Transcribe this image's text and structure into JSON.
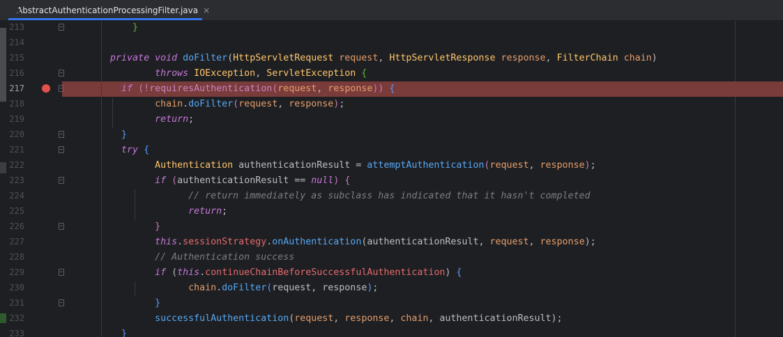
{
  "tab": {
    "filename": "AbstractAuthenticationProcessingFilter.java",
    "close": "×"
  },
  "editor": {
    "breakpoint_line": "217",
    "lines": [
      {
        "num": "213",
        "indent": 0,
        "tokens": [
          {
            "t": "        ",
            "c": "plain"
          },
          {
            "t": "}",
            "c": "brace-g"
          }
        ]
      },
      {
        "num": "214",
        "tokens": []
      },
      {
        "num": "215",
        "tokens": [
          {
            "t": "    ",
            "c": "plain"
          },
          {
            "t": "private ",
            "c": "purpleK"
          },
          {
            "t": "void ",
            "c": "purpleK"
          },
          {
            "t": "doFilter",
            "c": "fn"
          },
          {
            "t": "(",
            "c": "plain"
          },
          {
            "t": "HttpServletRequest ",
            "c": "tyY"
          },
          {
            "t": "request",
            "c": "arg"
          },
          {
            "t": ", ",
            "c": "plain"
          },
          {
            "t": "HttpServletResponse ",
            "c": "tyY"
          },
          {
            "t": "response",
            "c": "arg"
          },
          {
            "t": ", ",
            "c": "plain"
          },
          {
            "t": "FilterChain ",
            "c": "tyY"
          },
          {
            "t": "chain",
            "c": "arg"
          },
          {
            "t": ")",
            "c": "plain"
          }
        ]
      },
      {
        "num": "216",
        "tokens": [
          {
            "t": "            ",
            "c": "plain"
          },
          {
            "t": "throws ",
            "c": "purpleK"
          },
          {
            "t": "IOException",
            "c": "tyY"
          },
          {
            "t": ", ",
            "c": "plain"
          },
          {
            "t": "ServletException ",
            "c": "tyY"
          },
          {
            "t": "{",
            "c": "brace-g"
          }
        ]
      },
      {
        "num": "217",
        "tokens": [
          {
            "t": "      ",
            "c": "plain"
          },
          {
            "t": "if ",
            "c": "purpleK"
          },
          {
            "t": "(!",
            "c": "brace-p"
          },
          {
            "t": "requiresAuthentication",
            "c": "call"
          },
          {
            "t": "(",
            "c": "brace-p"
          },
          {
            "t": "request",
            "c": "arg"
          },
          {
            "t": ", ",
            "c": "plain"
          },
          {
            "t": "response",
            "c": "arg"
          },
          {
            "t": ")) ",
            "c": "brace-p"
          },
          {
            "t": "{",
            "c": "brace-b"
          }
        ]
      },
      {
        "num": "218",
        "tokens": [
          {
            "t": "            ",
            "c": "plain"
          },
          {
            "t": "chain",
            "c": "arg"
          },
          {
            "t": ".",
            "c": "plain"
          },
          {
            "t": "doFilter",
            "c": "fn"
          },
          {
            "t": "(",
            "c": "brace-p"
          },
          {
            "t": "request",
            "c": "arg"
          },
          {
            "t": ", ",
            "c": "plain"
          },
          {
            "t": "response",
            "c": "arg"
          },
          {
            "t": ")",
            "c": "brace-p"
          },
          {
            "t": ";",
            "c": "plain"
          }
        ]
      },
      {
        "num": "219",
        "tokens": [
          {
            "t": "            ",
            "c": "plain"
          },
          {
            "t": "return",
            "c": "ret"
          },
          {
            "t": ";",
            "c": "plain"
          }
        ]
      },
      {
        "num": "220",
        "tokens": [
          {
            "t": "      ",
            "c": "plain"
          },
          {
            "t": "}",
            "c": "brace-b"
          }
        ]
      },
      {
        "num": "221",
        "tokens": [
          {
            "t": "      ",
            "c": "plain"
          },
          {
            "t": "try ",
            "c": "purpleK"
          },
          {
            "t": "{",
            "c": "brace-b"
          }
        ]
      },
      {
        "num": "222",
        "tokens": [
          {
            "t": "            ",
            "c": "plain"
          },
          {
            "t": "Authentication ",
            "c": "tyY"
          },
          {
            "t": "authenticationResult = ",
            "c": "plain"
          },
          {
            "t": "attemptAuthentication",
            "c": "fn"
          },
          {
            "t": "(",
            "c": "brace-p"
          },
          {
            "t": "request",
            "c": "arg"
          },
          {
            "t": ", ",
            "c": "plain"
          },
          {
            "t": "response",
            "c": "arg"
          },
          {
            "t": ")",
            "c": "brace-p"
          },
          {
            "t": ";",
            "c": "plain"
          }
        ]
      },
      {
        "num": "223",
        "tokens": [
          {
            "t": "            ",
            "c": "plain"
          },
          {
            "t": "if ",
            "c": "purpleK"
          },
          {
            "t": "(",
            "c": "brace-p"
          },
          {
            "t": "authenticationResult == ",
            "c": "plain"
          },
          {
            "t": "null",
            "c": "purpleK"
          },
          {
            "t": ") ",
            "c": "brace-p"
          },
          {
            "t": "{",
            "c": "brace-p"
          }
        ]
      },
      {
        "num": "224",
        "tokens": [
          {
            "t": "                  ",
            "c": "plain"
          },
          {
            "t": "// return immediately as subclass has indicated that it hasn't completed",
            "c": "cmt"
          }
        ]
      },
      {
        "num": "225",
        "tokens": [
          {
            "t": "                  ",
            "c": "plain"
          },
          {
            "t": "return",
            "c": "ret"
          },
          {
            "t": ";",
            "c": "plain"
          }
        ]
      },
      {
        "num": "226",
        "tokens": [
          {
            "t": "            ",
            "c": "plain"
          },
          {
            "t": "}",
            "c": "brace-p"
          }
        ]
      },
      {
        "num": "227",
        "tokens": [
          {
            "t": "            ",
            "c": "plain"
          },
          {
            "t": "this",
            "c": "this"
          },
          {
            "t": ".",
            "c": "plain"
          },
          {
            "t": "sessionStrategy",
            "c": "field"
          },
          {
            "t": ".",
            "c": "plain"
          },
          {
            "t": "onAuthentication",
            "c": "fn"
          },
          {
            "t": "(",
            "c": "plain"
          },
          {
            "t": "authenticationResult, ",
            "c": "plain"
          },
          {
            "t": "request",
            "c": "arg"
          },
          {
            "t": ", ",
            "c": "plain"
          },
          {
            "t": "response",
            "c": "arg"
          },
          {
            "t": ");",
            "c": "plain"
          }
        ]
      },
      {
        "num": "228",
        "tokens": [
          {
            "t": "            ",
            "c": "plain"
          },
          {
            "t": "// Authentication success",
            "c": "cmt"
          }
        ]
      },
      {
        "num": "229",
        "tokens": [
          {
            "t": "            ",
            "c": "plain"
          },
          {
            "t": "if ",
            "c": "purpleK"
          },
          {
            "t": "(",
            "c": "plain"
          },
          {
            "t": "this",
            "c": "this"
          },
          {
            "t": ".",
            "c": "plain"
          },
          {
            "t": "continueChainBeforeSuccessfulAuthentication",
            "c": "field"
          },
          {
            "t": ") ",
            "c": "plain"
          },
          {
            "t": "{",
            "c": "brace-b"
          }
        ]
      },
      {
        "num": "230",
        "tokens": [
          {
            "t": "                  ",
            "c": "plain"
          },
          {
            "t": "chain",
            "c": "arg"
          },
          {
            "t": ".",
            "c": "plain"
          },
          {
            "t": "doFilter",
            "c": "fn"
          },
          {
            "t": "(",
            "c": "brace-b"
          },
          {
            "t": "request",
            "c": "plain"
          },
          {
            "t": ", ",
            "c": "plain"
          },
          {
            "t": "response",
            "c": "plain"
          },
          {
            "t": ")",
            "c": "brace-b"
          },
          {
            "t": ";",
            "c": "plain"
          }
        ]
      },
      {
        "num": "231",
        "tokens": [
          {
            "t": "            ",
            "c": "plain"
          },
          {
            "t": "}",
            "c": "brace-b"
          }
        ]
      },
      {
        "num": "232",
        "tokens": [
          {
            "t": "            ",
            "c": "plain"
          },
          {
            "t": "successfulAuthentication",
            "c": "fn"
          },
          {
            "t": "(",
            "c": "plain"
          },
          {
            "t": "request",
            "c": "arg"
          },
          {
            "t": ", ",
            "c": "plain"
          },
          {
            "t": "response",
            "c": "arg"
          },
          {
            "t": ", ",
            "c": "plain"
          },
          {
            "t": "chain",
            "c": "arg"
          },
          {
            "t": ", ",
            "c": "plain"
          },
          {
            "t": "authenticationResult",
            "c": "plain"
          },
          {
            "t": ");",
            "c": "plain"
          }
        ]
      },
      {
        "num": "233",
        "tokens": [
          {
            "t": "      ",
            "c": "plain"
          },
          {
            "t": "}",
            "c": "brace-b"
          }
        ]
      }
    ]
  },
  "fold_lines": [
    "213",
    "216",
    "217",
    "220",
    "221",
    "223",
    "226",
    "229",
    "231"
  ]
}
